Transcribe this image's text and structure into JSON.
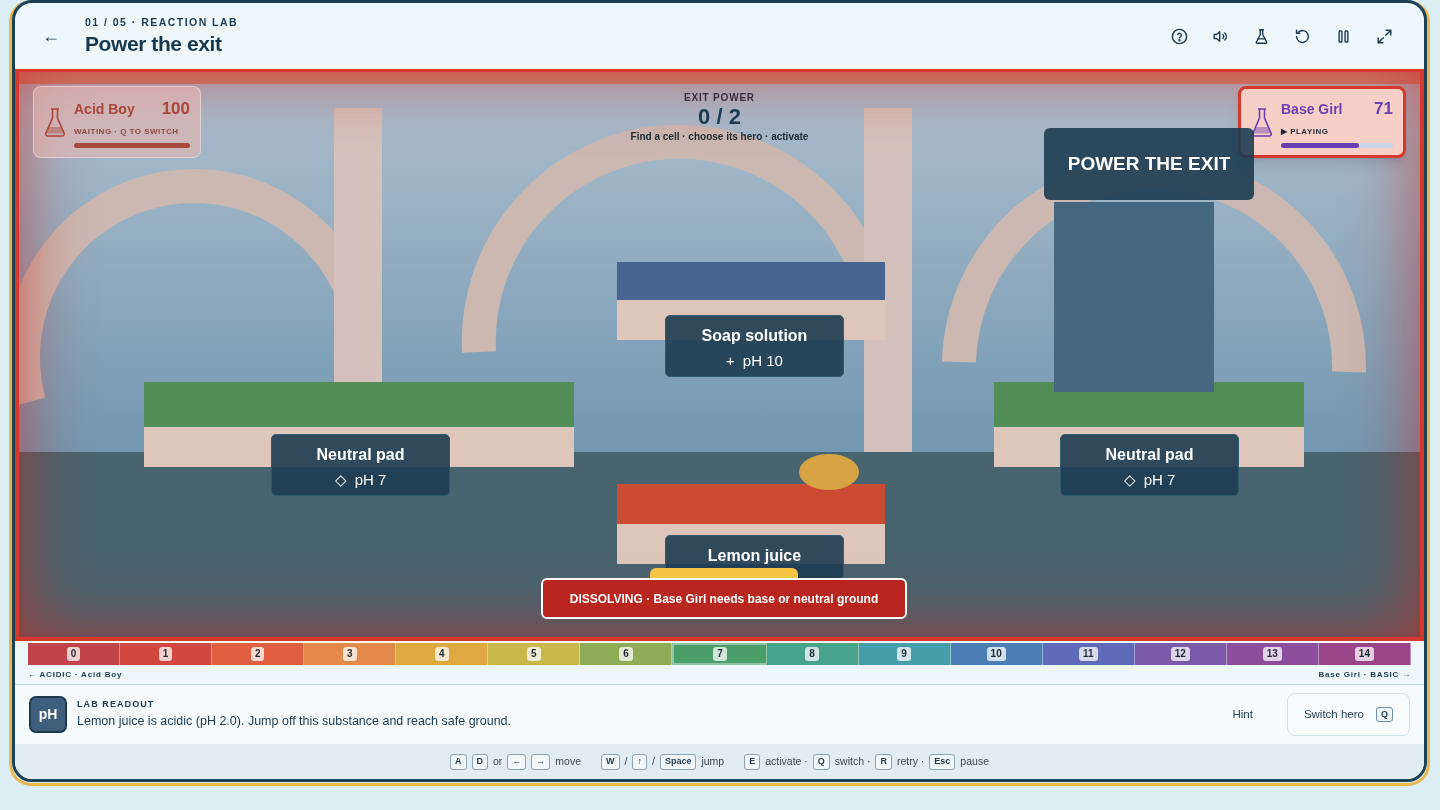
{
  "header": {
    "back_label": "←",
    "breadcrumb": "01 / 05 · REACTION LAB",
    "title": "Power the exit",
    "toolbar": [
      {
        "kind": "help"
      },
      {
        "kind": "sound"
      },
      {
        "kind": "flask"
      },
      {
        "kind": "retry"
      },
      {
        "kind": "pause"
      },
      {
        "kind": "fullscreen"
      }
    ]
  },
  "game": {
    "danger": true,
    "heroes": [
      {
        "name": "Acid Boy",
        "score": "100",
        "status": "WAITING · Q TO SWITCH",
        "selected": false,
        "level": 1.0,
        "color": "#a8473c"
      },
      {
        "name": "Base Girl",
        "score": "71",
        "status": "▶ PLAYING",
        "selected": true,
        "level": 0.7,
        "color": "#6a3fb0"
      }
    ],
    "exit_power": {
      "label": "EXIT POWER",
      "value": "0 / 2",
      "hint": "Find a cell · choose its hero · activate"
    },
    "sign": "POWER THE EXIT",
    "platform_labels": [
      {
        "name": "Neutral pad",
        "symbol": "◇",
        "ph": "pH 7"
      },
      {
        "name": "Soap solution",
        "symbol": "+",
        "ph": "pH 10"
      },
      {
        "name": "Neutral pad",
        "symbol": "◇",
        "ph": "pH 7"
      },
      {
        "name": "Lemon juice"
      }
    ],
    "alert": "DISSOLVING · Base Girl needs base or neutral ground"
  },
  "ph_scale": {
    "cells": [
      {
        "label": "0",
        "color": "#c0444a",
        "selected": false
      },
      {
        "label": "1",
        "color": "#d2473f",
        "selected": false
      },
      {
        "label": "2",
        "color": "#df5f40",
        "selected": false
      },
      {
        "label": "3",
        "color": "#e38a4a",
        "selected": false
      },
      {
        "label": "4",
        "color": "#dea940",
        "selected": false
      },
      {
        "label": "5",
        "color": "#c8b74b",
        "selected": false
      },
      {
        "label": "6",
        "color": "#8fac57",
        "selected": false
      },
      {
        "label": "7",
        "color": "#4a9e6a",
        "selected": true
      },
      {
        "label": "8",
        "color": "#48a48a",
        "selected": false
      },
      {
        "label": "9",
        "color": "#489dab",
        "selected": false
      },
      {
        "label": "10",
        "color": "#4b7fb4",
        "selected": false
      },
      {
        "label": "11",
        "color": "#5f6bb8",
        "selected": false
      },
      {
        "label": "12",
        "color": "#7a5aa9",
        "selected": false
      },
      {
        "label": "13",
        "color": "#8d4e9d",
        "selected": false
      },
      {
        "label": "14",
        "color": "#9a4589",
        "selected": false
      }
    ],
    "left_label": "← ACIDIC · Acid Boy",
    "right_label": "Base Girl · BASIC →"
  },
  "readout": {
    "badge": "pH",
    "title": "LAB READOUT",
    "text": "Lemon juice is acidic (pH 2.0). Jump off this substance and reach safe ground.",
    "hint_button": "Hint",
    "switch_button": "Switch hero",
    "switch_key": "Q"
  },
  "key_hints": [
    {
      "kind": "key",
      "text": "A"
    },
    {
      "kind": "key",
      "text": "D"
    },
    {
      "kind": "text",
      "text": "or"
    },
    {
      "kind": "key",
      "text": "←"
    },
    {
      "kind": "key",
      "text": "→"
    },
    {
      "kind": "text",
      "text": "move"
    },
    {
      "kind": "gap"
    },
    {
      "kind": "key",
      "text": "W"
    },
    {
      "kind": "text",
      "text": "/"
    },
    {
      "kind": "key",
      "text": "↑"
    },
    {
      "kind": "text",
      "text": "/"
    },
    {
      "kind": "key",
      "text": "Space"
    },
    {
      "kind": "text",
      "text": "jump"
    },
    {
      "kind": "gap"
    },
    {
      "kind": "key",
      "text": "E"
    },
    {
      "kind": "text",
      "text": "activate ·"
    },
    {
      "kind": "key",
      "text": "Q"
    },
    {
      "kind": "text",
      "text": "switch ·"
    },
    {
      "kind": "key",
      "text": "R"
    },
    {
      "kind": "text",
      "text": "retry ·"
    },
    {
      "kind": "key",
      "text": "Esc"
    },
    {
      "kind": "text",
      "text": "pause"
    }
  ]
}
